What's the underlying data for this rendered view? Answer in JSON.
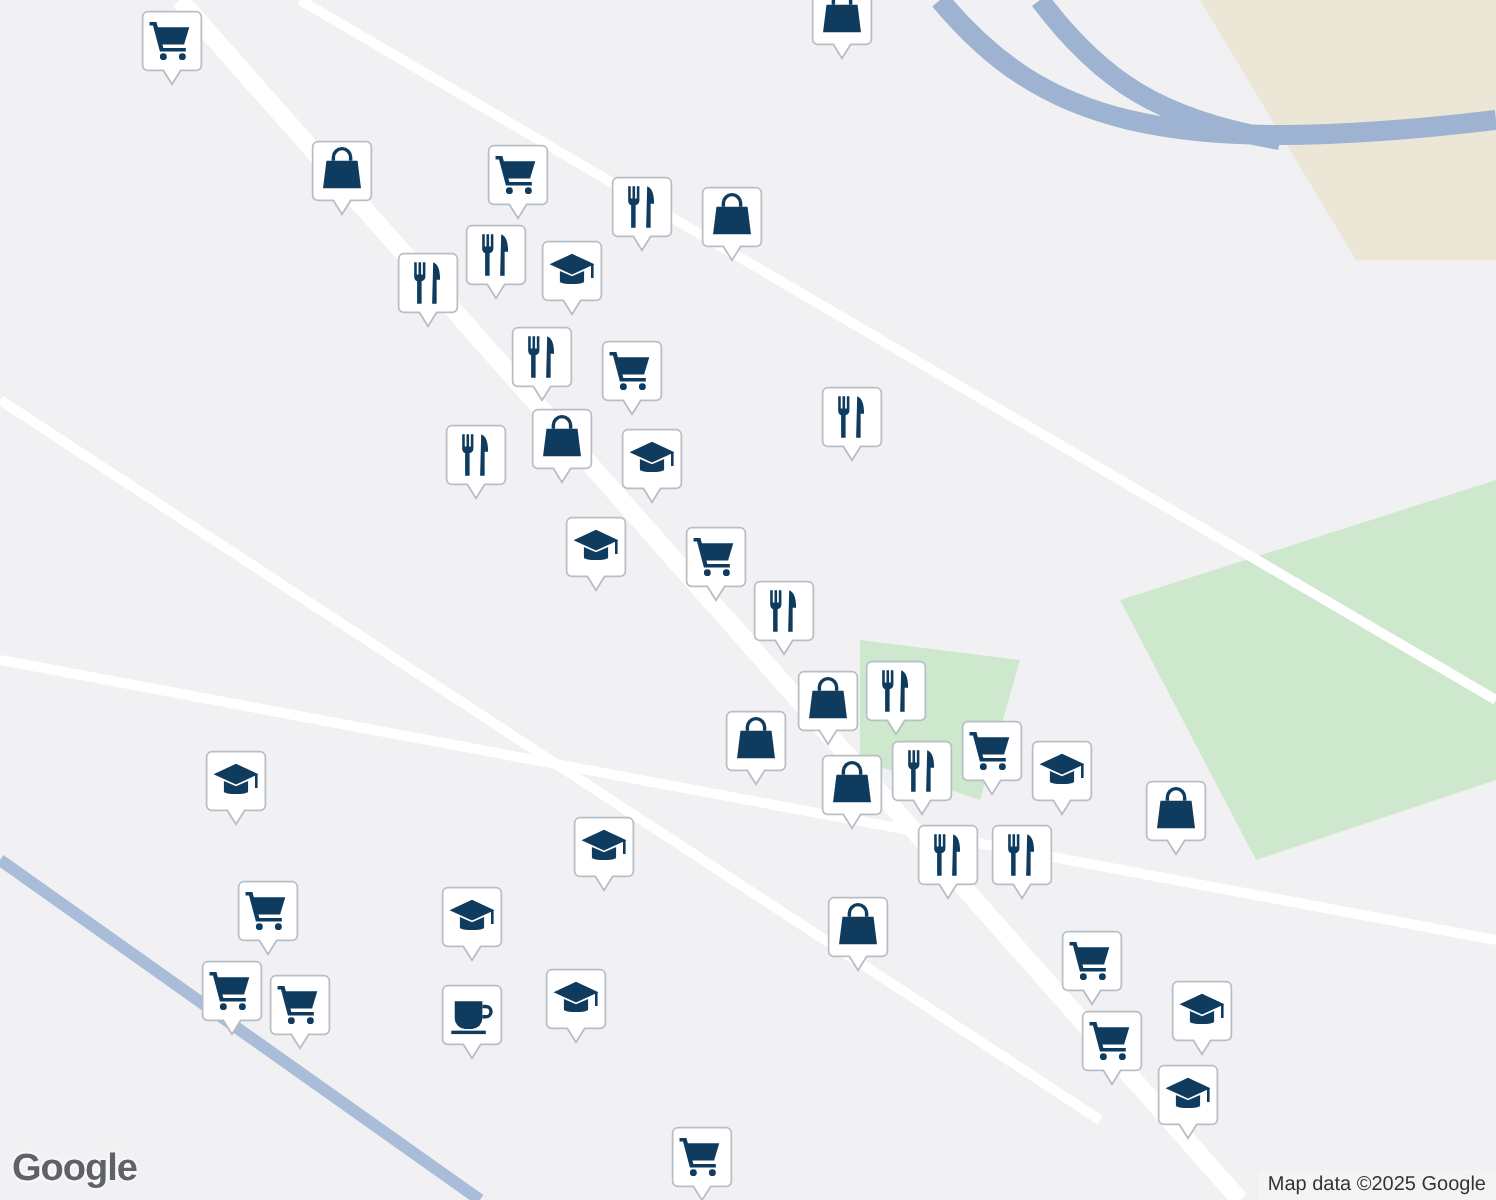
{
  "markers": [
    {
      "kind": "cart"
    },
    {
      "kind": "bag"
    },
    {
      "kind": "bag"
    },
    {
      "kind": "cart"
    },
    {
      "kind": "fork"
    },
    {
      "kind": "bag"
    },
    {
      "kind": "fork"
    },
    {
      "kind": "fork"
    },
    {
      "kind": "cap"
    },
    {
      "kind": "fork"
    },
    {
      "kind": "cart"
    },
    {
      "kind": "bag"
    },
    {
      "kind": "fork"
    },
    {
      "kind": "cap"
    },
    {
      "kind": "fork"
    },
    {
      "kind": "cap"
    },
    {
      "kind": "cart"
    },
    {
      "kind": "fork"
    },
    {
      "kind": "bag"
    },
    {
      "kind": "fork"
    },
    {
      "kind": "fork"
    },
    {
      "kind": "bag"
    },
    {
      "kind": "bag"
    },
    {
      "kind": "cart"
    },
    {
      "kind": "cap"
    },
    {
      "kind": "fork"
    },
    {
      "kind": "fork"
    },
    {
      "kind": "bag"
    },
    {
      "kind": "cap"
    },
    {
      "kind": "cap"
    },
    {
      "kind": "cart"
    },
    {
      "kind": "cap"
    },
    {
      "kind": "cart"
    },
    {
      "kind": "cart"
    },
    {
      "kind": "bag"
    },
    {
      "kind": "cup"
    },
    {
      "kind": "cap"
    },
    {
      "kind": "cart"
    },
    {
      "kind": "cart"
    },
    {
      "kind": "cap"
    },
    {
      "kind": "cap"
    },
    {
      "kind": "cart"
    }
  ],
  "logo": "Google",
  "attribution": "Map data ©2025 Google"
}
